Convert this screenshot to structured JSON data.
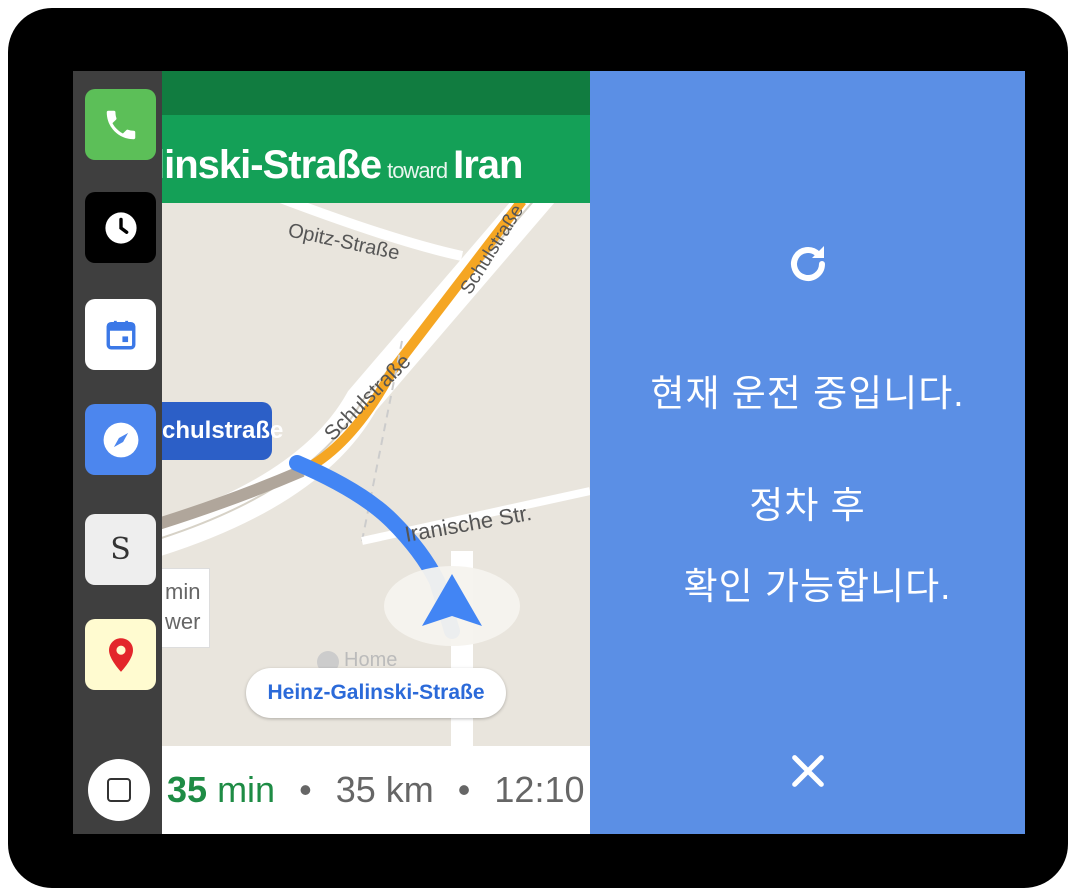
{
  "dock": {
    "apps": [
      {
        "name": "phone-app",
        "icon": "phone-icon"
      },
      {
        "name": "clock-app",
        "icon": "clock-icon"
      },
      {
        "name": "calendar-app",
        "icon": "calendar-icon"
      },
      {
        "name": "navigation-app",
        "icon": "compass-icon"
      },
      {
        "name": "s-app",
        "icon": "letter-s-icon",
        "label": "S"
      },
      {
        "name": "maps-app",
        "icon": "map-pin-icon"
      }
    ],
    "home_icon": "square-icon"
  },
  "navigation": {
    "banner_street": "linski-Straße",
    "banner_toward": "toward",
    "banner_destination": "Iran",
    "current_street": "chulstraße",
    "road_labels": {
      "opitz": "Opitz-Straße",
      "schulstrasse_a": "Schulstraße",
      "schulstrasse_b": "Schulstraße",
      "iranische": "Iranische Str."
    },
    "poi_line1": "min",
    "poi_line2": "wer",
    "home_poi": "Home",
    "destination": "Heinz-Galinski-Straße",
    "eta": {
      "duration_value": "35",
      "duration_unit": "min",
      "separator": "•",
      "distance": "35 km",
      "arrival": "12:10"
    }
  },
  "panel": {
    "message_line1": "현재 운전 중입니다.",
    "message_line2": "정차 후",
    "message_line3": "확인 가능합니다.",
    "refresh_icon": "refresh-icon",
    "close_icon": "close-icon"
  },
  "colors": {
    "panel_bg": "#5b8fe5",
    "banner_green": "#14a057",
    "route_blue": "#4285f4",
    "eta_green": "#1e8c45"
  }
}
